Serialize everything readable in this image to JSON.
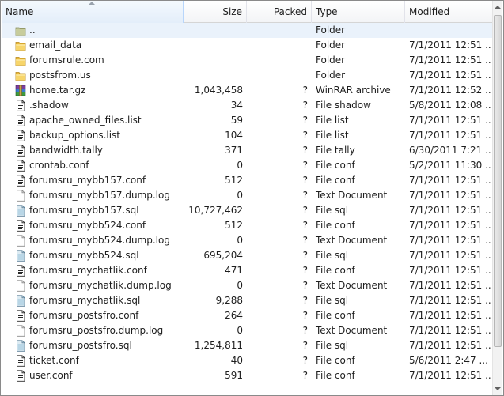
{
  "columns": {
    "name": "Name",
    "size": "Size",
    "packed": "Packed",
    "type": "Type",
    "modified": "Modified"
  },
  "files": [
    {
      "name": "..",
      "size": "",
      "packed": "",
      "type": "Folder",
      "modified": "",
      "icon": "folder-up-icon"
    },
    {
      "name": "email_data",
      "size": "",
      "packed": "",
      "type": "Folder",
      "modified": "7/1/2011 12:51 ...",
      "icon": "folder-icon"
    },
    {
      "name": "forumsrule.com",
      "size": "",
      "packed": "",
      "type": "Folder",
      "modified": "7/1/2011 12:51 ...",
      "icon": "folder-icon"
    },
    {
      "name": "postsfrom.us",
      "size": "",
      "packed": "",
      "type": "Folder",
      "modified": "7/1/2011 12:51 ...",
      "icon": "folder-icon"
    },
    {
      "name": "home.tar.gz",
      "size": "1,043,458",
      "packed": "?",
      "type": "WinRAR archive",
      "modified": "7/1/2011 12:52 ...",
      "icon": "winrar-archive-icon"
    },
    {
      "name": ".shadow",
      "size": "34",
      "packed": "?",
      "type": "File shadow",
      "modified": "5/8/2011 12:08 ...",
      "icon": "file-icon"
    },
    {
      "name": "apache_owned_files.list",
      "size": "59",
      "packed": "?",
      "type": "File list",
      "modified": "7/1/2011 12:51 ...",
      "icon": "file-icon"
    },
    {
      "name": "backup_options.list",
      "size": "104",
      "packed": "?",
      "type": "File list",
      "modified": "7/1/2011 12:51 ...",
      "icon": "file-icon"
    },
    {
      "name": "bandwidth.tally",
      "size": "371",
      "packed": "?",
      "type": "File tally",
      "modified": "6/30/2011 7:21 ...",
      "icon": "file-icon"
    },
    {
      "name": "crontab.conf",
      "size": "0",
      "packed": "?",
      "type": "File conf",
      "modified": "5/2/2011 11:30 ...",
      "icon": "file-icon"
    },
    {
      "name": "forumsru_mybb157.conf",
      "size": "512",
      "packed": "?",
      "type": "File conf",
      "modified": "7/1/2011 12:51 ...",
      "icon": "file-icon"
    },
    {
      "name": "forumsru_mybb157.dump.log",
      "size": "0",
      "packed": "?",
      "type": "Text Document",
      "modified": "7/1/2011 12:51 ...",
      "icon": "text-document-icon"
    },
    {
      "name": "forumsru_mybb157.sql",
      "size": "10,727,462",
      "packed": "?",
      "type": "File sql",
      "modified": "7/1/2011 12:51 ...",
      "icon": "sql-file-icon"
    },
    {
      "name": "forumsru_mybb524.conf",
      "size": "512",
      "packed": "?",
      "type": "File conf",
      "modified": "7/1/2011 12:51 ...",
      "icon": "file-icon"
    },
    {
      "name": "forumsru_mybb524.dump.log",
      "size": "0",
      "packed": "?",
      "type": "Text Document",
      "modified": "7/1/2011 12:51 ...",
      "icon": "text-document-icon"
    },
    {
      "name": "forumsru_mybb524.sql",
      "size": "695,204",
      "packed": "?",
      "type": "File sql",
      "modified": "7/1/2011 12:51 ...",
      "icon": "sql-file-icon"
    },
    {
      "name": "forumsru_mychatlik.conf",
      "size": "471",
      "packed": "?",
      "type": "File conf",
      "modified": "7/1/2011 12:51 ...",
      "icon": "file-icon"
    },
    {
      "name": "forumsru_mychatlik.dump.log",
      "size": "0",
      "packed": "?",
      "type": "Text Document",
      "modified": "7/1/2011 12:51 ...",
      "icon": "text-document-icon"
    },
    {
      "name": "forumsru_mychatlik.sql",
      "size": "9,288",
      "packed": "?",
      "type": "File sql",
      "modified": "7/1/2011 12:51 ...",
      "icon": "sql-file-icon"
    },
    {
      "name": "forumsru_postsfro.conf",
      "size": "264",
      "packed": "?",
      "type": "File conf",
      "modified": "7/1/2011 12:51 ...",
      "icon": "file-icon"
    },
    {
      "name": "forumsru_postsfro.dump.log",
      "size": "0",
      "packed": "?",
      "type": "Text Document",
      "modified": "7/1/2011 12:51 ...",
      "icon": "text-document-icon"
    },
    {
      "name": "forumsru_postsfro.sql",
      "size": "1,254,811",
      "packed": "?",
      "type": "File sql",
      "modified": "7/1/2011 12:51 ...",
      "icon": "sql-file-icon"
    },
    {
      "name": "ticket.conf",
      "size": "40",
      "packed": "?",
      "type": "File conf",
      "modified": "5/6/2011 2:47 ...",
      "icon": "file-icon"
    },
    {
      "name": "user.conf",
      "size": "591",
      "packed": "?",
      "type": "File conf",
      "modified": "7/1/2011 12:51 ...",
      "icon": "file-icon"
    }
  ]
}
